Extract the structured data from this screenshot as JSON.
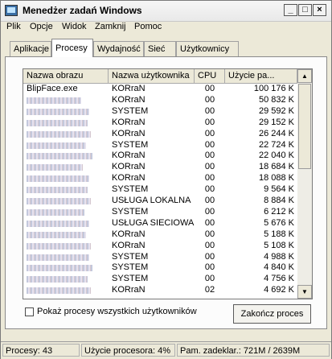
{
  "window": {
    "title": "Menedżer zadań Windows"
  },
  "menu": [
    "Plik",
    "Opcje",
    "Widok",
    "Zamknij",
    "Pomoc"
  ],
  "tabs": [
    "Aplikacje",
    "Procesy",
    "Wydajność",
    "Sieć",
    "Użytkownicy"
  ],
  "active_tab": "Procesy",
  "table": {
    "columns": [
      "Nazwa obrazu",
      "Nazwa użytkownika",
      "CPU",
      "Użycie pa..."
    ],
    "rows": [
      {
        "name": "BlipFace.exe",
        "user": "KORraN",
        "cpu": "00",
        "mem": "100 176 K"
      },
      {
        "name": "",
        "user": "KORraN",
        "cpu": "00",
        "mem": "50 832 K"
      },
      {
        "name": "",
        "user": "SYSTEM",
        "cpu": "00",
        "mem": "29 592 K"
      },
      {
        "name": "",
        "user": "KORraN",
        "cpu": "00",
        "mem": "29 152 K"
      },
      {
        "name": "",
        "user": "KORraN",
        "cpu": "00",
        "mem": "26 244 K"
      },
      {
        "name": "",
        "user": "SYSTEM",
        "cpu": "00",
        "mem": "22 724 K"
      },
      {
        "name": "",
        "user": "KORraN",
        "cpu": "00",
        "mem": "22 040 K"
      },
      {
        "name": "",
        "user": "KORraN",
        "cpu": "00",
        "mem": "18 684 K"
      },
      {
        "name": "",
        "user": "KORraN",
        "cpu": "00",
        "mem": "18 088 K"
      },
      {
        "name": "",
        "user": "SYSTEM",
        "cpu": "00",
        "mem": "9 564 K"
      },
      {
        "name": "",
        "user": "USŁUGA LOKALNA",
        "cpu": "00",
        "mem": "8 884 K"
      },
      {
        "name": "",
        "user": "SYSTEM",
        "cpu": "00",
        "mem": "6 212 K"
      },
      {
        "name": "",
        "user": "USŁUGA SIECIOWA",
        "cpu": "00",
        "mem": "5 676 K"
      },
      {
        "name": "",
        "user": "KORraN",
        "cpu": "00",
        "mem": "5 188 K"
      },
      {
        "name": "",
        "user": "KORraN",
        "cpu": "00",
        "mem": "5 108 K"
      },
      {
        "name": "",
        "user": "SYSTEM",
        "cpu": "00",
        "mem": "4 988 K"
      },
      {
        "name": "",
        "user": "SYSTEM",
        "cpu": "00",
        "mem": "4 840 K"
      },
      {
        "name": "",
        "user": "SYSTEM",
        "cpu": "00",
        "mem": "4 756 K"
      },
      {
        "name": "",
        "user": "KORraN",
        "cpu": "02",
        "mem": "4 692 K"
      }
    ]
  },
  "show_all_processes": {
    "label": "Pokaż procesy wszystkich użytkowników",
    "checked": false
  },
  "end_process_button": "Zakończ proces",
  "status": {
    "processes": "Procesy: 43",
    "cpu_usage": "Użycie procesora: 4%",
    "commit": "Pam. zadeklar.: 721M / 2639M"
  }
}
